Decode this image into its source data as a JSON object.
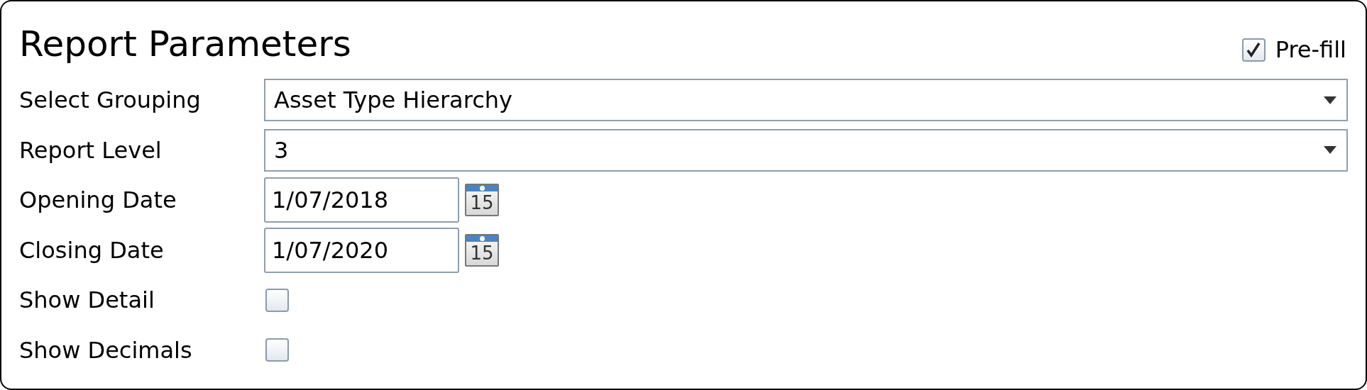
{
  "title": "Report Parameters",
  "prefill": {
    "label": "Pre-fill",
    "checked": true
  },
  "fields": [
    {
      "kind": "select",
      "label": "Select Grouping",
      "value": "Asset Type Hierarchy"
    },
    {
      "kind": "select",
      "label": "Report Level",
      "value": "3"
    },
    {
      "kind": "date",
      "label": "Opening Date",
      "value": "1/07/2018",
      "calendar_day": "15"
    },
    {
      "kind": "date",
      "label": "Closing Date",
      "value": "1/07/2020",
      "calendar_day": "15"
    },
    {
      "kind": "checkbox",
      "label": "Show Detail",
      "checked": false
    },
    {
      "kind": "checkbox",
      "label": "Show Decimals",
      "checked": false
    }
  ]
}
